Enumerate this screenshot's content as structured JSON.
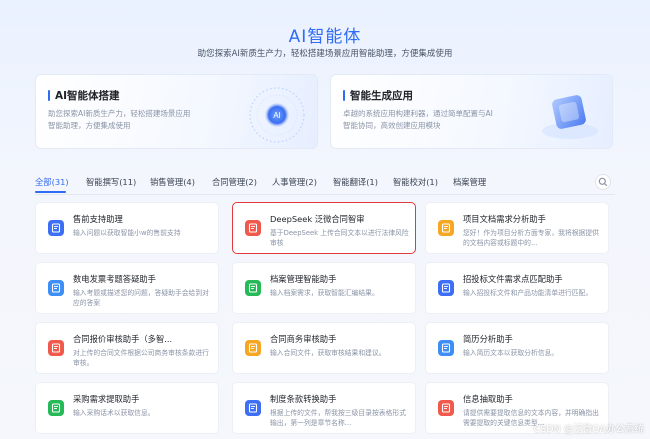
{
  "header": {
    "title": "AI智能体",
    "subtitle": "助您探索AI新质生产力，轻松搭建场景应用智能助理，方便集成使用"
  },
  "features": [
    {
      "title": "AI智能体搭建",
      "desc": "助您探索AI新质生产力，轻松搭建场景应用 智能助理，方便集成使用",
      "art_label": "AI"
    },
    {
      "title": "智能生成应用",
      "desc": "卓越的系统应用构建利器，通过简单配置与AI智能协同，高效创建应用模块"
    }
  ],
  "tabs": [
    {
      "label": "全部(31)",
      "active": true
    },
    {
      "label": "智能撰写(11)"
    },
    {
      "label": "销售管理(4)"
    },
    {
      "label": "合同管理(2)"
    },
    {
      "label": "人事管理(2)"
    },
    {
      "label": "智能翻译(1)"
    },
    {
      "label": "智能校对(1)"
    },
    {
      "label": "档案管理"
    }
  ],
  "search_icon": "search-icon",
  "cards": [
    {
      "title": "售前支持助理",
      "desc": "输入问题以获取智能小w的售前支持",
      "icon_color": "#3d6ff5",
      "icon": "chat-icon"
    },
    {
      "title": "DeepSeek 泛微合同智审",
      "desc": "基于DeepSeek 上传合同文本以进行法律风险审核",
      "icon_color": "#ef5a4c",
      "icon": "contract-icon",
      "selected": true
    },
    {
      "title": "项目文档需求分析助手",
      "desc": "您好！作为项目分析方面专家，我将根据提供的文档内容或标题中的...",
      "icon_color": "#f5a623",
      "icon": "document-icon"
    },
    {
      "title": "数电发票考题答疑助手",
      "desc": "输入考题或描述您的问题，答疑助手会给到对应的答案",
      "icon_color": "#3d8ef5",
      "icon": "invoice-icon"
    },
    {
      "title": "档案管理智能助手",
      "desc": "输入档案需求，获取智能汇编结果。",
      "icon_color": "#26b957",
      "icon": "archive-icon"
    },
    {
      "title": "招投标文件需求点匹配助手",
      "desc": "输入招投标文件和产品功能清单进行匹配。",
      "icon_color": "#3d6ff5",
      "icon": "bid-icon"
    },
    {
      "title": "合同报价审核助手（多智...",
      "desc": "对上传的合同文件根据公司商务审核条款进行审核。",
      "icon_color": "#ef5a4c",
      "icon": "quote-icon"
    },
    {
      "title": "合同商务审核助手",
      "desc": "输入合同文件，获取审核结果和建议。",
      "icon_color": "#f5a623",
      "icon": "review-icon"
    },
    {
      "title": "简历分析助手",
      "desc": "输入简历文本以获取分析信息。",
      "icon_color": "#3d8ef5",
      "icon": "resume-icon"
    },
    {
      "title": "采购需求提取助手",
      "desc": "输入采购话术以获取信息。",
      "icon_color": "#26b957",
      "icon": "purchase-icon"
    },
    {
      "title": "制度条款转换助手",
      "desc": "根据上传的文件，帮我按三级目录按表格形式输出，第一列是章节名称...",
      "icon_color": "#3d6ff5",
      "icon": "policy-icon"
    },
    {
      "title": "信息抽取助手",
      "desc": "请提供需要提取信息的文本内容，并明确指出需要提取的关键信息类型...",
      "icon_color": "#ef5a4c",
      "icon": "extract-icon"
    }
  ],
  "watermark": "CSDN @泛微OA办公系统"
}
